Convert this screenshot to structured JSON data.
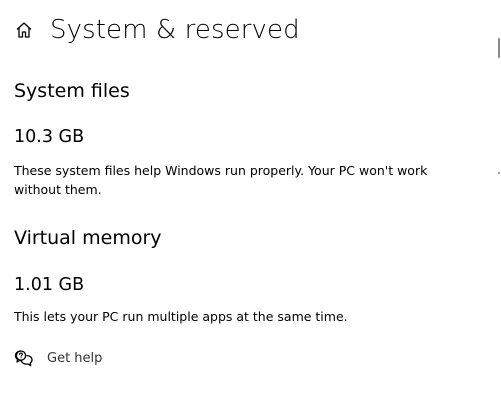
{
  "window": {
    "title": "System & reserved",
    "home_icon": "home-icon"
  },
  "sections": [
    {
      "title": "System files",
      "value": "10.3 GB",
      "description": "These system files help Windows run properly. Your PC won't work without them."
    },
    {
      "title": "Virtual memory",
      "value": "1.01 GB",
      "description": "This lets your PC run multiple apps at the same time."
    }
  ],
  "help": {
    "label": "Get help",
    "icon": "chat-help-icon"
  }
}
